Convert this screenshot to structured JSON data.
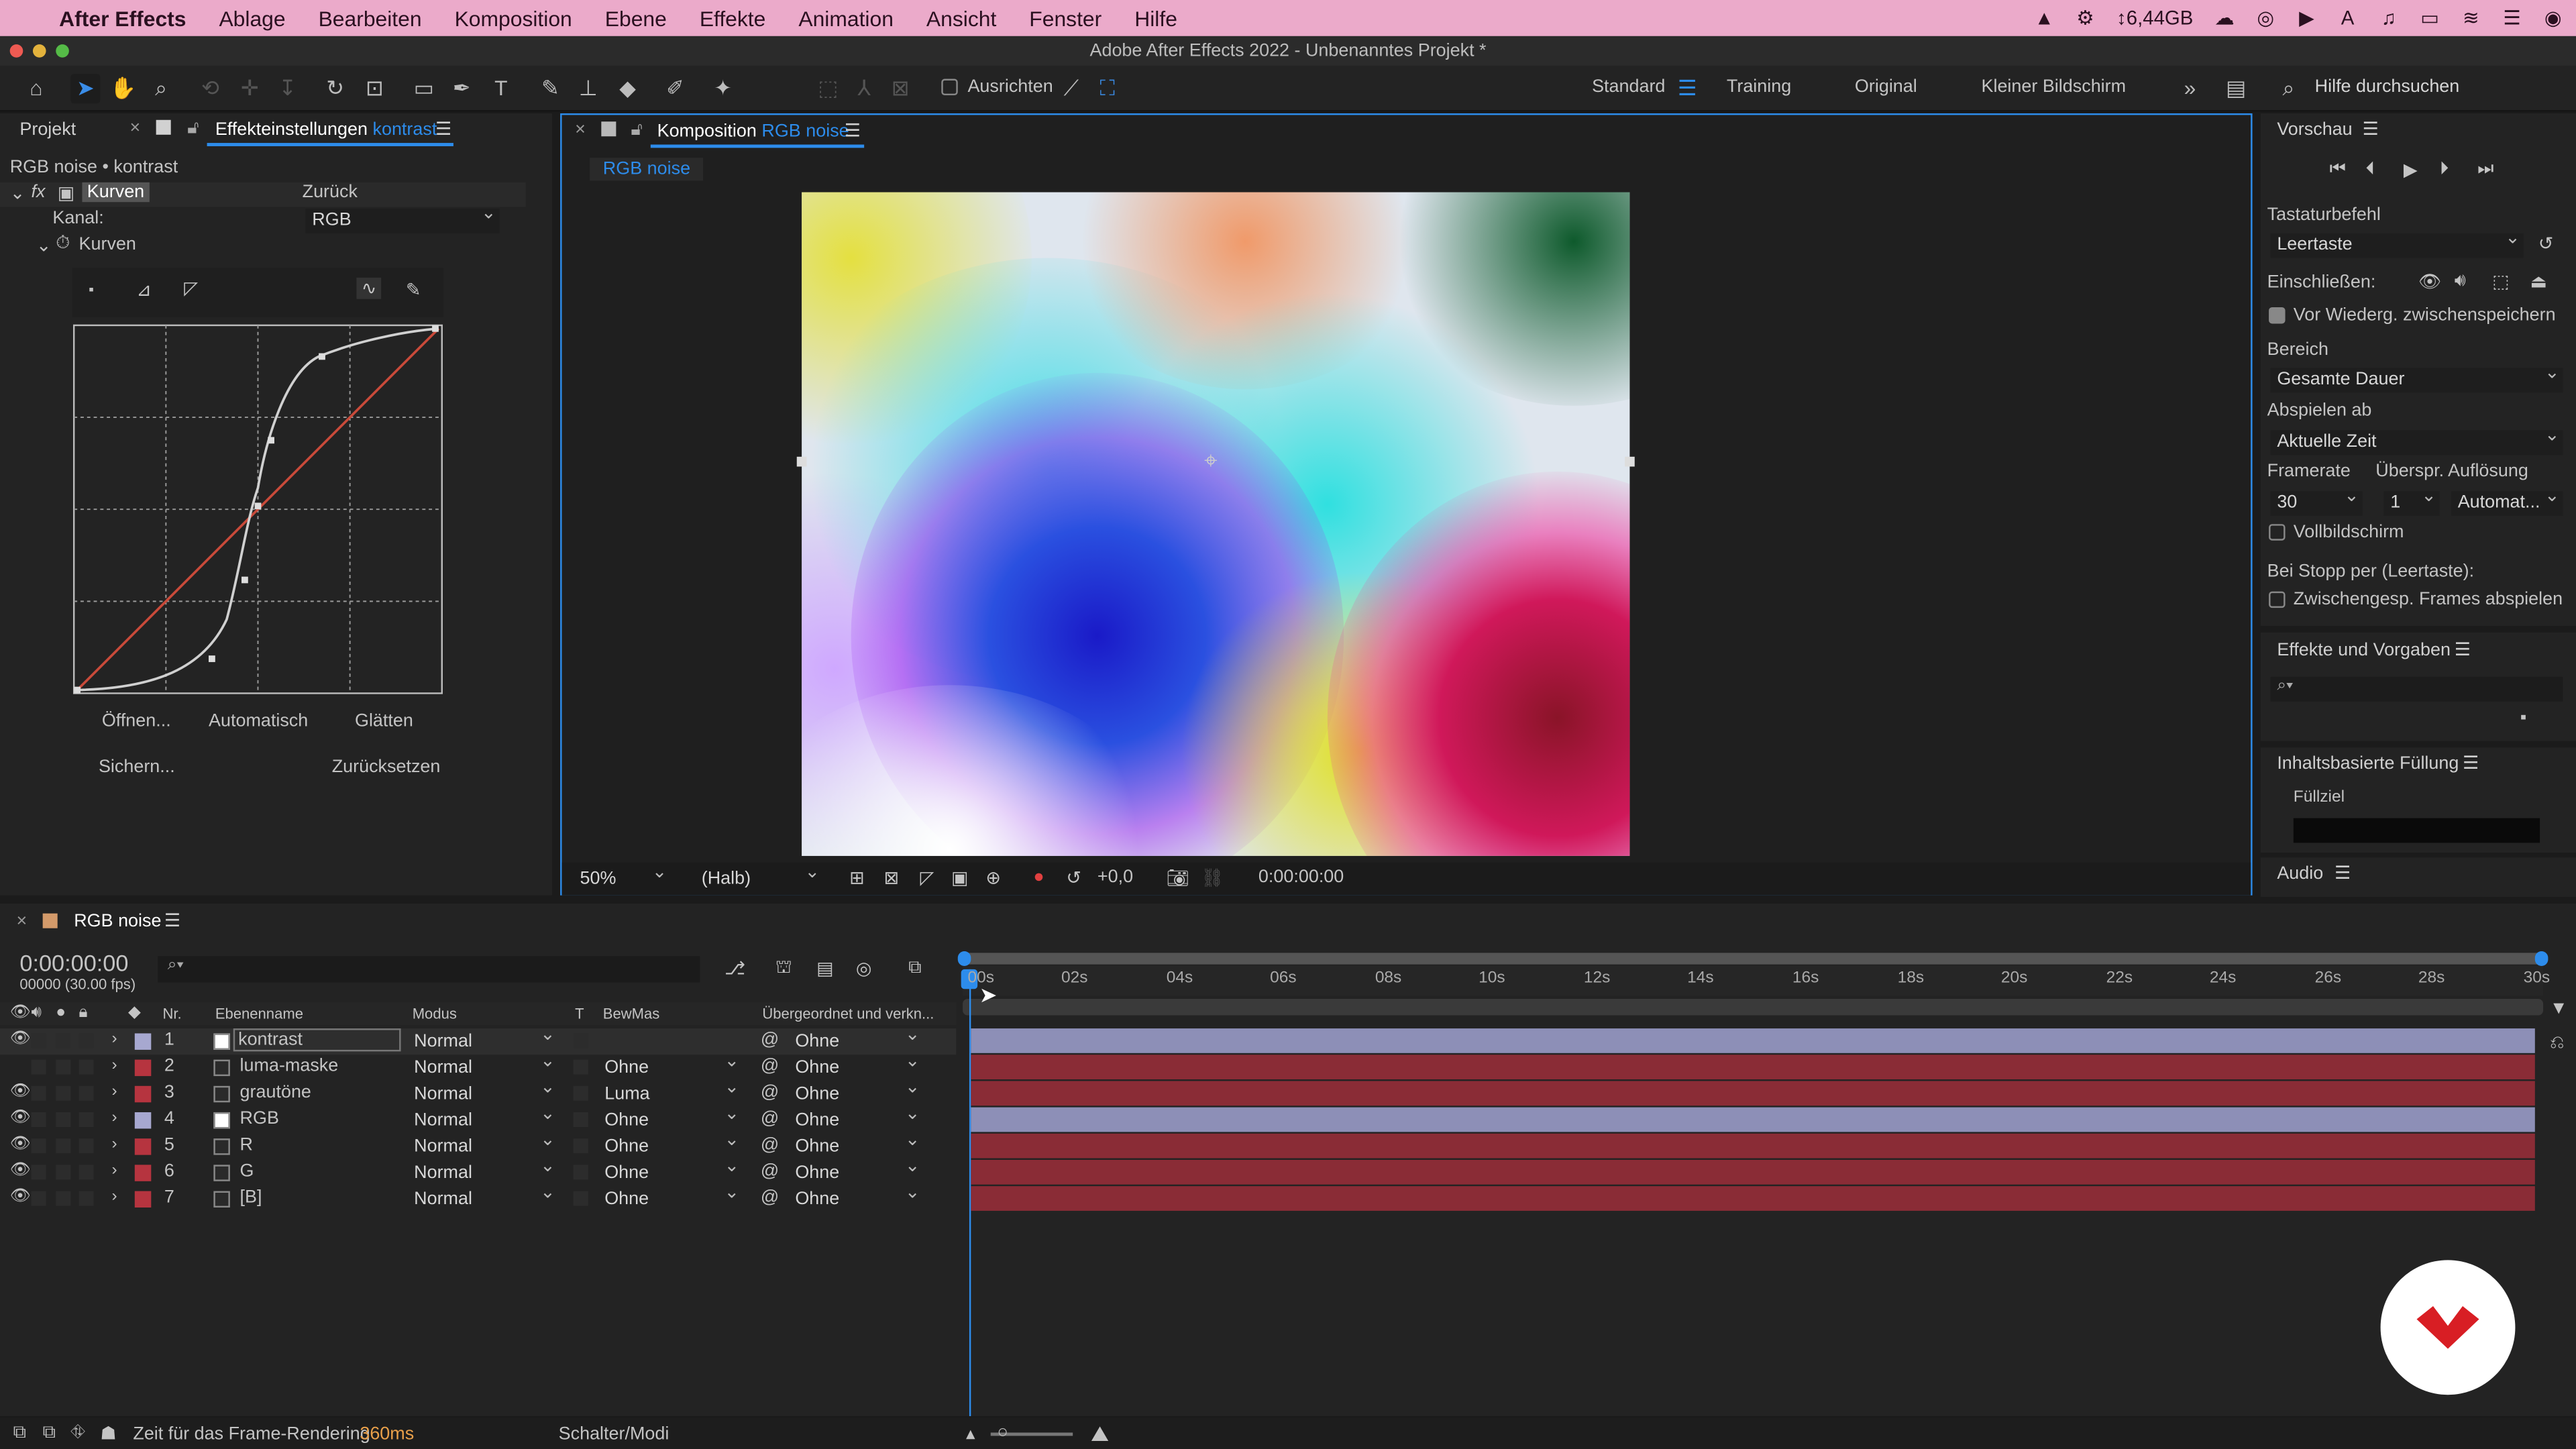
{
  "menubar": {
    "app": "After Effects",
    "items": [
      "Ablage",
      "Bearbeiten",
      "Komposition",
      "Ebene",
      "Effekte",
      "Animation",
      "Ansicht",
      "Fenster",
      "Hilfe"
    ],
    "storage": "6,44GB"
  },
  "window": {
    "title": "Adobe After Effects 2022 - Unbenanntes Projekt *"
  },
  "toolbar": {
    "snap": "Ausrichten",
    "workspaces": [
      "Standard",
      "Training",
      "Original",
      "Kleiner Bildschirm"
    ],
    "help_search": "Hilfe durchsuchen"
  },
  "left": {
    "tab_project": "Projekt",
    "tab_effects": "Effekteinstellungen",
    "tab_effects_layer": "kontrast",
    "breadcrumb": "RGB noise • kontrast",
    "effect_name": "Kurven",
    "reset": "Zurück",
    "channel_label": "Kanal:",
    "channel_value": "RGB",
    "curves_label": "Kurven",
    "btn_open": "Öffnen...",
    "btn_auto": "Automatisch",
    "btn_smooth": "Glätten",
    "btn_save": "Sichern...",
    "btn_reset": "Zurücksetzen"
  },
  "comp": {
    "tab_prefix": "Komposition",
    "tab_name": "RGB noise",
    "subtab": "RGB noise",
    "zoom": "50%",
    "quality": "(Halb)",
    "exposure": "+0,0",
    "timecode": "0:00:00:00"
  },
  "right": {
    "preview_title": "Vorschau",
    "shortcut_label": "Tastaturbefehl",
    "shortcut_value": "Leertaste",
    "include_label": "Einschließen:",
    "cache_label": "Vor Wiederg. zwischenspeichern",
    "range_label": "Bereich",
    "range_value": "Gesamte Dauer",
    "play_from_label": "Abspielen ab",
    "play_from_value": "Aktuelle Zeit",
    "framerate_label": "Framerate",
    "skip_label": "Überspr.",
    "resolution_label": "Auflösung",
    "framerate_value": "30",
    "skip_value": "1",
    "resolution_value": "Automat...",
    "fullscreen_label": "Vollbildschirm",
    "on_stop_label": "Bei Stopp per (Leertaste):",
    "cached_frames_label": "Zwischengesp. Frames abspielen",
    "effects_title": "Effekte und Vorgaben",
    "fill_title": "Inhaltsbasierte Füllung",
    "fill_target": "Füllziel",
    "audio_title": "Audio"
  },
  "timeline": {
    "tab_name": "RGB noise",
    "timecode": "0:00:00:00",
    "frames": "00000 (30.00 fps)",
    "headers": {
      "nr": "Nr.",
      "name": "Ebenenname",
      "mode": "Modus",
      "t": "T",
      "trkmat": "BewMas",
      "parent": "Übergeordnet und verkn..."
    },
    "ruler": [
      "00s",
      "02s",
      "04s",
      "06s",
      "08s",
      "10s",
      "12s",
      "14s",
      "16s",
      "18s",
      "20s",
      "22s",
      "24s",
      "26s",
      "28s",
      "30s"
    ],
    "layers": [
      {
        "nr": "1",
        "name": "kontrast",
        "mode": "Normal",
        "trkmat": "",
        "parent": "Ohne",
        "label": "#a7a8d0",
        "bar": "#8d8fb7"
      },
      {
        "nr": "2",
        "name": "luma-maske",
        "mode": "Normal",
        "trkmat": "Ohne",
        "parent": "Ohne",
        "label": "#b6343f",
        "bar": "#8a2c36"
      },
      {
        "nr": "3",
        "name": "grautöne",
        "mode": "Normal",
        "trkmat": "Luma",
        "parent": "Ohne",
        "label": "#b6343f",
        "bar": "#8a2c36"
      },
      {
        "nr": "4",
        "name": "RGB",
        "mode": "Normal",
        "trkmat": "Ohne",
        "parent": "Ohne",
        "label": "#a7a8d0",
        "bar": "#8d8fb7"
      },
      {
        "nr": "5",
        "name": "R",
        "mode": "Normal",
        "trkmat": "Ohne",
        "parent": "Ohne",
        "label": "#b6343f",
        "bar": "#8a2c36"
      },
      {
        "nr": "6",
        "name": "G",
        "mode": "Normal",
        "trkmat": "Ohne",
        "parent": "Ohne",
        "label": "#b6343f",
        "bar": "#8a2c36"
      },
      {
        "nr": "7",
        "name": "[B]",
        "mode": "Normal",
        "trkmat": "Ohne",
        "parent": "Ohne",
        "label": "#b6343f",
        "bar": "#8a2c36"
      }
    ]
  },
  "status": {
    "render_label": "Zeit für das Frame-Rendering",
    "render_value": "360ms",
    "toggle": "Schalter/Modi"
  }
}
